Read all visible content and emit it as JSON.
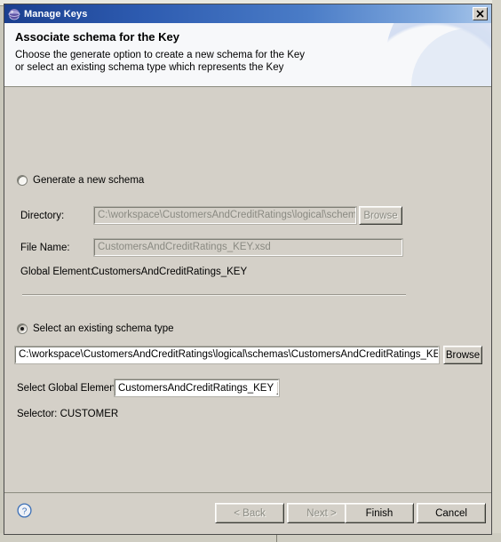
{
  "window": {
    "title": "Manage Keys",
    "icon": "eclipse-globe-icon",
    "close_label": "×"
  },
  "header": {
    "title": "Associate schema for the Key",
    "description_line1": "Choose the generate option to create a new schema for the Key",
    "description_line2": "or select an existing schema type which represents the Key"
  },
  "generate_section": {
    "radio_label": "Generate a new schema",
    "radio_selected": false,
    "directory": {
      "label": "Directory:",
      "value": "C:\\workspace\\CustomersAndCreditRatings\\logical\\schemas",
      "enabled": false
    },
    "file_name": {
      "label": "File Name:",
      "value": "CustomersAndCreditRatings_KEY.xsd",
      "enabled": false
    },
    "browse_label": "Browse",
    "global_element": {
      "label": "Global Element:",
      "value": "CustomersAndCreditRatings_KEY"
    }
  },
  "existing_section": {
    "radio_label": "Select an existing schema type",
    "radio_selected": true,
    "schema_path": "C:\\workspace\\CustomersAndCreditRatings\\logical\\schemas\\CustomersAndCreditRatings_KEY.xsd",
    "browse_label": "Browse",
    "global_element": {
      "label": "Select Global Element",
      "selected": "CustomersAndCreditRatings_KEY",
      "options": [
        "CustomersAndCreditRatings_KEY"
      ]
    },
    "selector": "Selector: CUSTOMER"
  },
  "footer": {
    "help_icon": "help-question-icon",
    "back_label": "< Back",
    "back_enabled": false,
    "next_label": "Next >",
    "next_enabled": false,
    "finish_label": "Finish",
    "cancel_label": "Cancel"
  },
  "colors": {
    "titlebar_start": "#1b3f8f",
    "titlebar_end": "#a8c6ea",
    "dialog_bg": "#d4d0c8",
    "header_bg": "#f7f8fa",
    "help_blue": "#3b6fb6"
  }
}
